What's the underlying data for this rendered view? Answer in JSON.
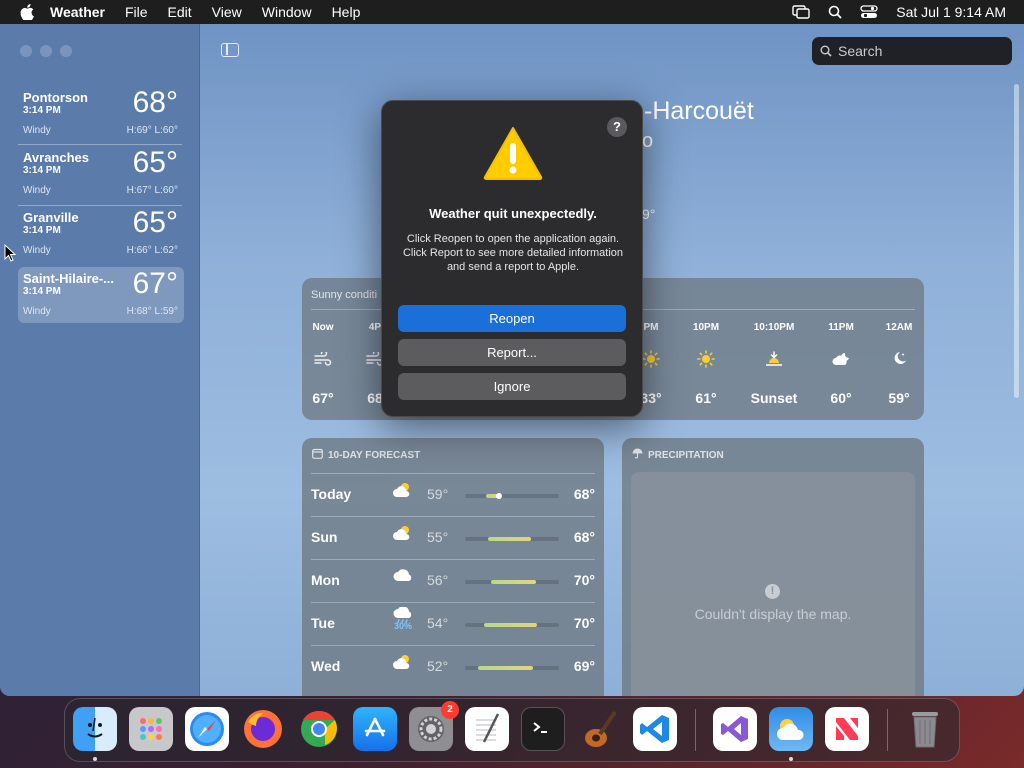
{
  "menubar": {
    "app_name": "Weather",
    "items": [
      "File",
      "Edit",
      "View",
      "Window",
      "Help"
    ],
    "clock": "Sat Jul 1  9:14 AM"
  },
  "search": {
    "placeholder": "Search"
  },
  "locations": [
    {
      "name": "Pontorson",
      "time": "3:14 PM",
      "condition": "Windy",
      "temp": "68°",
      "hl": "H:69°  L:60°"
    },
    {
      "name": "Avranches",
      "time": "3:14 PM",
      "condition": "Windy",
      "temp": "65°",
      "hl": "H:67°  L:60°"
    },
    {
      "name": "Granville",
      "time": "3:14 PM",
      "condition": "Windy",
      "temp": "65°",
      "hl": "H:66°  L:62°"
    },
    {
      "name": "Saint-Hilaire-...",
      "time": "3:14 PM",
      "condition": "Windy",
      "temp": "67°",
      "hl": "H:68°  L:59°"
    }
  ],
  "main": {
    "city_fragment": "-Harcouët",
    "temp_fragment": "o",
    "hl_fragment": "9°"
  },
  "hourly": {
    "summary": "Sunny conditi",
    "hours": [
      {
        "label": "Now",
        "icon": "wind-icon",
        "temp": "67°"
      },
      {
        "label": "4P",
        "icon": "wind-icon",
        "temp": "68"
      },
      {
        "label": "PM",
        "icon": "sun-icon",
        "temp": "33°"
      },
      {
        "label": "10PM",
        "icon": "sun-icon",
        "temp": "61°"
      },
      {
        "label": "10:10PM",
        "icon": "sunset-icon",
        "temp": "Sunset"
      },
      {
        "label": "11PM",
        "icon": "cloud-moon-icon",
        "temp": "60°"
      },
      {
        "label": "12AM",
        "icon": "moon-icon",
        "temp": "59°"
      }
    ]
  },
  "forecast": {
    "heading": "10-DAY FORECAST",
    "rows": [
      {
        "day": "Today",
        "icon": "partly-sunny-icon",
        "low": "59°",
        "high": "68°",
        "precip": "",
        "range": [
          0.22,
          0.38
        ],
        "current": 0.36
      },
      {
        "day": "Sun",
        "icon": "partly-sunny-icon",
        "low": "55°",
        "high": "68°",
        "precip": "",
        "range": [
          0.24,
          0.7
        ],
        "current": null
      },
      {
        "day": "Mon",
        "icon": "cloud-icon",
        "low": "56°",
        "high": "70°",
        "precip": "",
        "range": [
          0.28,
          0.76
        ],
        "current": null
      },
      {
        "day": "Tue",
        "icon": "rain-cloud-icon",
        "low": "54°",
        "high": "70°",
        "precip": "30%",
        "range": [
          0.2,
          0.76
        ],
        "current": null
      },
      {
        "day": "Wed",
        "icon": "partly-sunny-icon",
        "low": "52°",
        "high": "69°",
        "precip": "",
        "range": [
          0.14,
          0.72
        ],
        "current": null
      }
    ]
  },
  "precipitation": {
    "heading": "PRECIPITATION",
    "message": "Couldn't display the map."
  },
  "dialog": {
    "help": "?",
    "title": "Weather quit unexpectedly.",
    "message": "Click Reopen to open the application again. Click Report to see more detailed information and send a report to Apple.",
    "buttons": {
      "reopen": "Reopen",
      "report": "Report...",
      "ignore": "Ignore"
    }
  },
  "dock": {
    "apps": [
      "Finder",
      "Launchpad",
      "Safari",
      "Firefox",
      "Chrome",
      "App Store",
      "System Settings",
      "TextEdit",
      "Terminal",
      "GarageBand",
      "VS Code",
      "Visual Studio",
      "Weather",
      "News",
      "Trash"
    ],
    "settings_badge": "2"
  }
}
